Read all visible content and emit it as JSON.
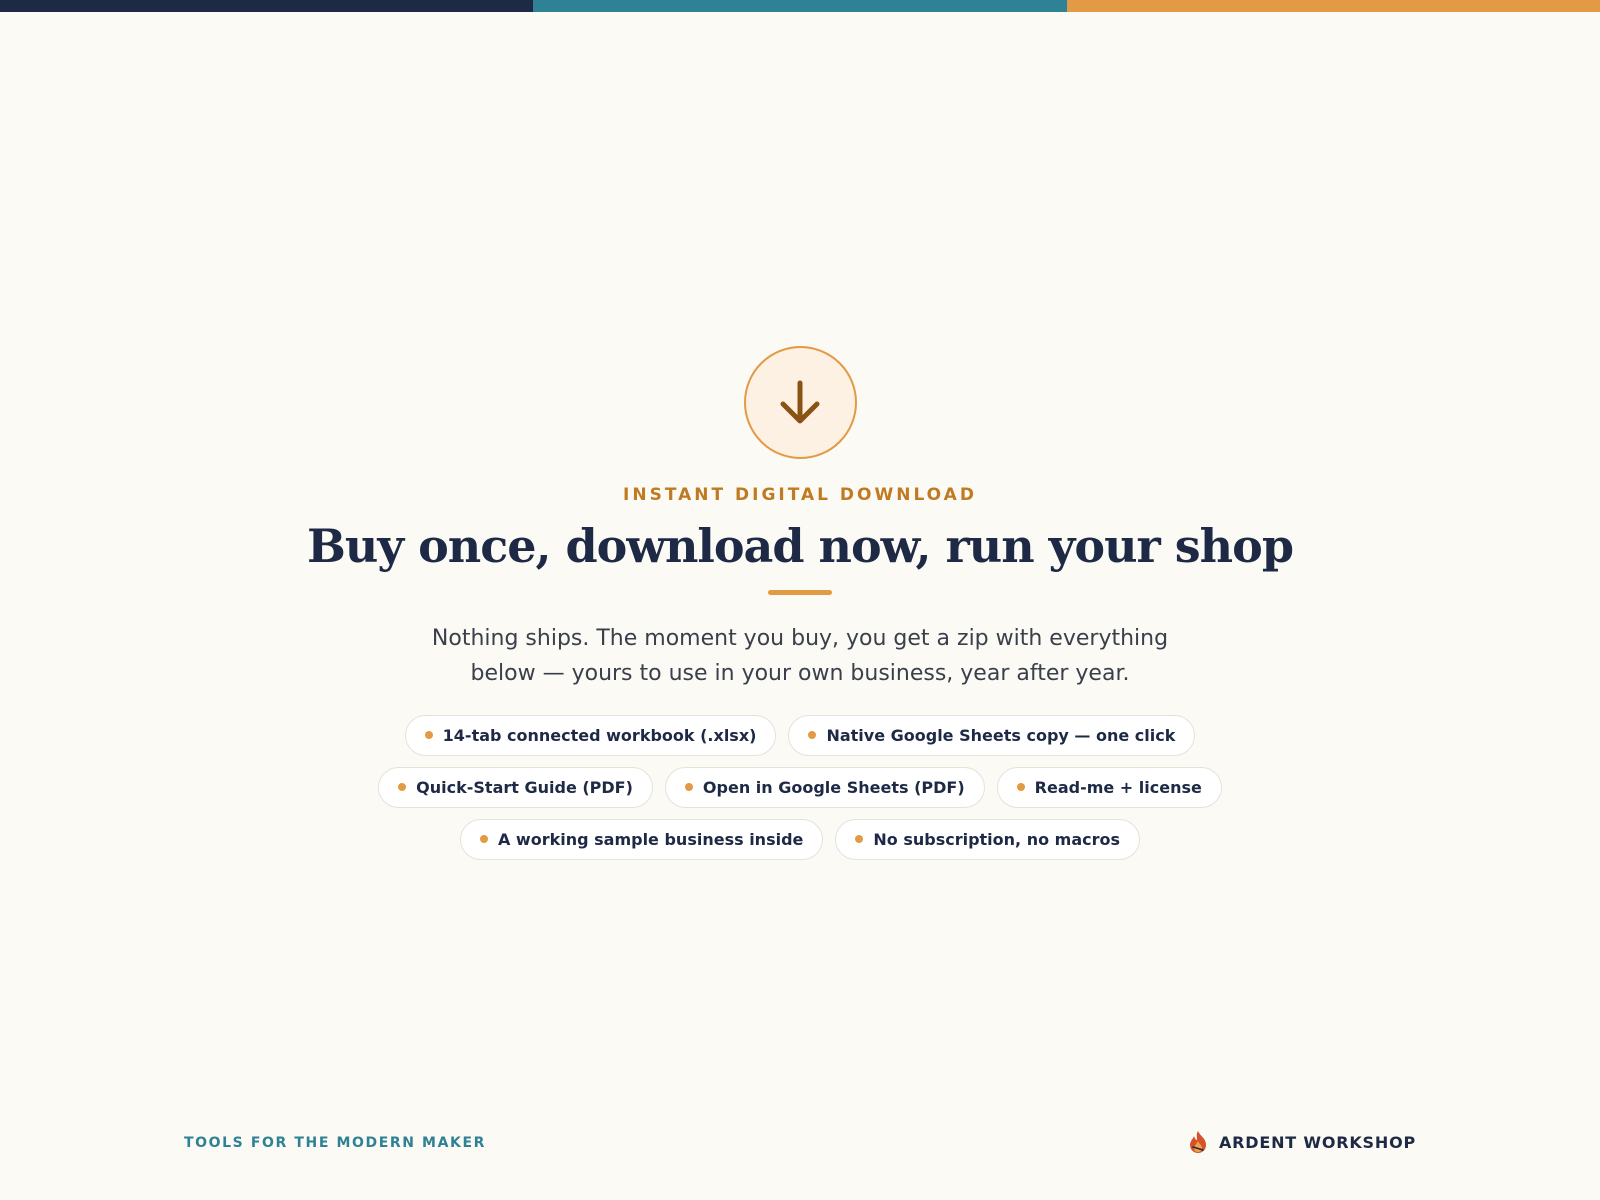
{
  "colors": {
    "navy": "#1e2a45",
    "teal": "#2f8295",
    "orange": "#e39a45",
    "amber_text": "#c07a22",
    "arrow_brown": "#8a5313",
    "background": "#fbfaf4"
  },
  "hero": {
    "icon": "download-arrow-icon",
    "eyebrow": "INSTANT DIGITAL DOWNLOAD",
    "headline": "Buy once, download now, run your shop",
    "subtitle": "Nothing ships. The moment you buy, you get a zip with everything below — yours to use in your own business, year after year."
  },
  "features": [
    [
      "14-tab connected workbook (.xlsx)",
      "Native Google Sheets copy — one click"
    ],
    [
      "Quick-Start Guide (PDF)",
      "Open in Google Sheets (PDF)",
      "Read-me + license"
    ],
    [
      "A working sample business inside",
      "No subscription, no macros"
    ]
  ],
  "footer": {
    "tagline": "TOOLS FOR THE MODERN MAKER",
    "brand": "ARDENT WORKSHOP",
    "brand_icon": "flame-logo-icon"
  }
}
